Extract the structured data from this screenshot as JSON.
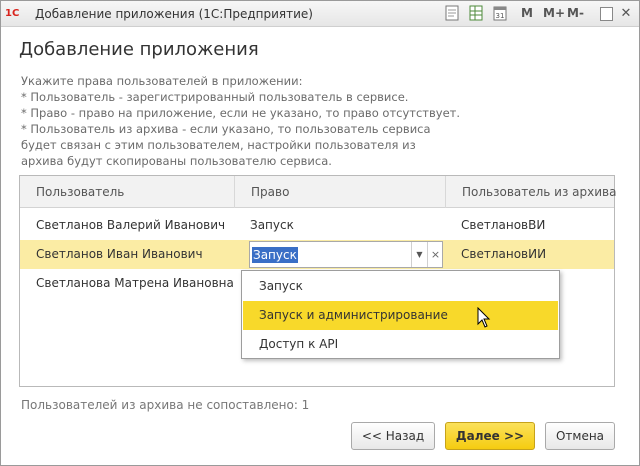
{
  "window": {
    "title": "Добавление приложения  (1С:Предприятие)",
    "logo": "1С",
    "toolbar": {
      "m": "M",
      "m_plus": "M+",
      "m_minus": "M-",
      "close": "✕"
    }
  },
  "form": {
    "title": "Добавление приложения",
    "instructions": [
      "Укажите права пользователей в приложении:",
      " * Пользователь - зарегистрированный пользователь в сервисе.",
      " * Право - право на приложение, если не указано, то право отсутствует.",
      " * Пользователь из архива - если указано, то пользователь сервиса",
      "    будет связан с этим пользователем, настройки пользователя из",
      "    архива будут скопированы пользователю сервиса."
    ]
  },
  "table": {
    "columns": [
      "Пользователь",
      "Право",
      "Пользователь из архива"
    ],
    "rows": [
      {
        "user": "Светланов Валерий Иванович",
        "right": "Запуск",
        "archive_user": "СветлановВИ"
      },
      {
        "user": "Светланов Иван Иванович",
        "right": "Запуск",
        "archive_user": "СветлановИИ"
      },
      {
        "user": "Светланова Матрена Ивановна",
        "right": "",
        "archive_user": ""
      }
    ],
    "selected_row": 1
  },
  "dropdown": {
    "options": [
      "Запуск",
      "Запуск и администрирование",
      "Доступ к API"
    ],
    "highlighted": 1
  },
  "status": "Пользователей из архива не сопоставлено: 1",
  "buttons": {
    "back": "<< Назад",
    "next": "Далее >>",
    "cancel": "Отмена"
  },
  "icons": {
    "dropdown": "triangle-down-icon",
    "clear": "clear-x-icon",
    "cursor": "mouse-pointer-icon"
  },
  "colors": {
    "selected_row": "#fbeca4",
    "highlight": "#f8d92a",
    "primary_button": "#f5cc10",
    "logo": "#d8231c"
  }
}
